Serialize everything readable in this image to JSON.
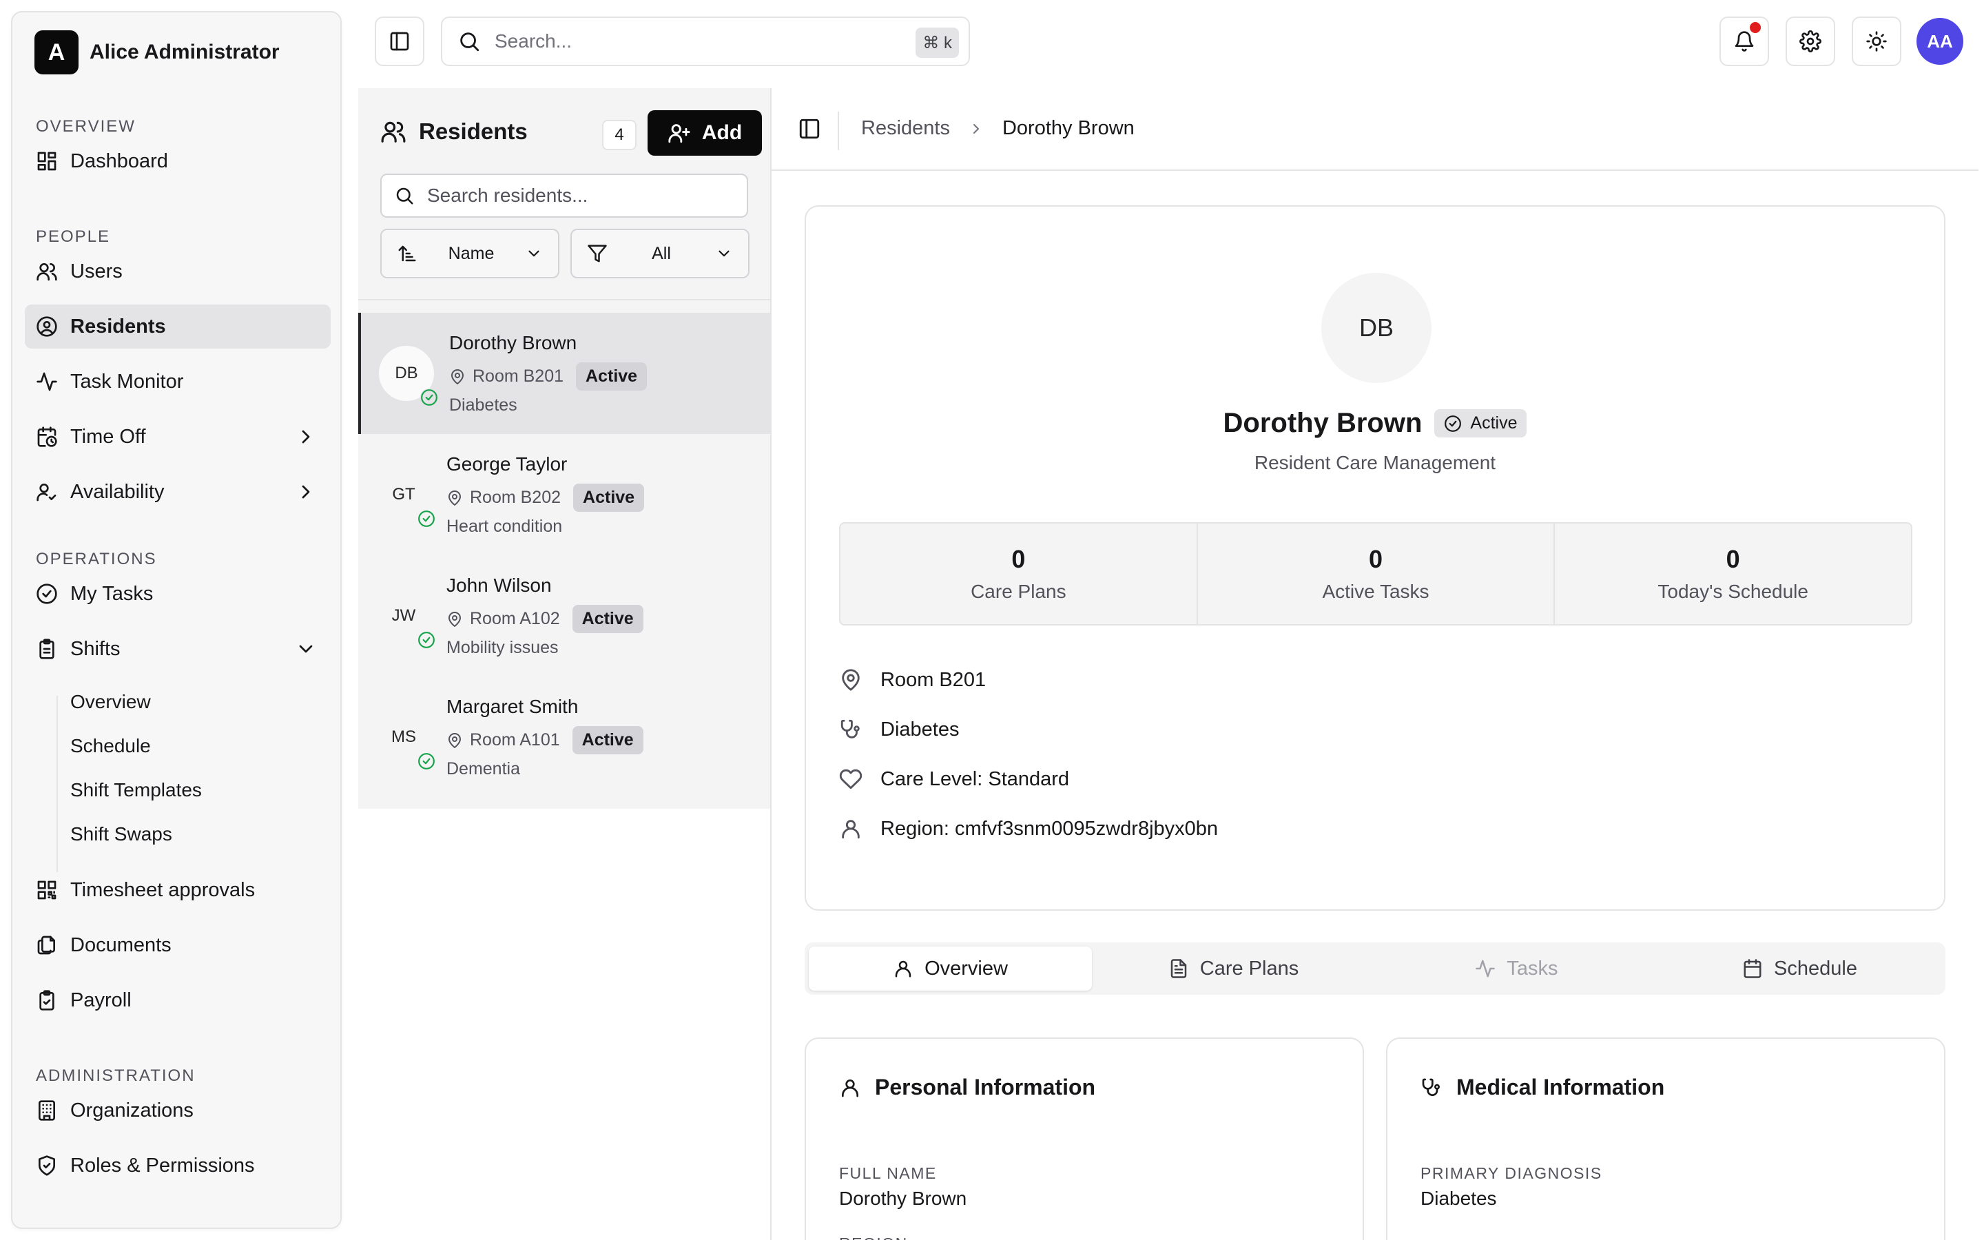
{
  "app": {
    "user_name": "Alice Administrator",
    "logo_letter": "A"
  },
  "sidebar": {
    "sections": {
      "overview": "OVERVIEW",
      "people": "PEOPLE",
      "operations": "OPERATIONS",
      "administration": "ADMINISTRATION"
    },
    "items": {
      "dashboard": "Dashboard",
      "users": "Users",
      "residents": "Residents",
      "task_monitor": "Task Monitor",
      "time_off": "Time Off",
      "availability": "Availability",
      "my_tasks": "My Tasks",
      "shifts": "Shifts",
      "timesheet_approvals": "Timesheet approvals",
      "documents": "Documents",
      "payroll": "Payroll",
      "organizations": "Organizations",
      "roles_permissions": "Roles & Permissions"
    },
    "shifts_sub": [
      "Overview",
      "Schedule",
      "Shift Templates",
      "Shift Swaps"
    ],
    "active_item": "Residents"
  },
  "topbar": {
    "search_placeholder": "Search...",
    "search_shortcut": "⌘ k",
    "avatar_initials": "AA",
    "has_notification": true
  },
  "residents_panel": {
    "title": "Residents",
    "count": "4",
    "add_label": "Add",
    "search_placeholder": "Search residents...",
    "sort_label": "Name",
    "filter_label": "All",
    "list": [
      {
        "initials": "DB",
        "name": "Dorothy Brown",
        "room": "Room B201",
        "status": "Active",
        "condition": "Diabetes",
        "selected": true
      },
      {
        "initials": "GT",
        "name": "George Taylor",
        "room": "Room B202",
        "status": "Active",
        "condition": "Heart condition",
        "selected": false
      },
      {
        "initials": "JW",
        "name": "John Wilson",
        "room": "Room A102",
        "status": "Active",
        "condition": "Mobility issues",
        "selected": false
      },
      {
        "initials": "MS",
        "name": "Margaret Smith",
        "room": "Room A101",
        "status": "Active",
        "condition": "Dementia",
        "selected": false
      }
    ]
  },
  "detail": {
    "breadcrumb": {
      "parent": "Residents",
      "current": "Dorothy Brown"
    },
    "profile": {
      "initials": "DB",
      "name": "Dorothy Brown",
      "status": "Active",
      "subtitle": "Resident Care Management"
    },
    "stats": [
      {
        "value": "0",
        "label": "Care Plans"
      },
      {
        "value": "0",
        "label": "Active Tasks"
      },
      {
        "value": "0",
        "label": "Today's Schedule"
      }
    ],
    "info": {
      "room": "Room B201",
      "condition": "Diabetes",
      "care_level": "Care Level: Standard",
      "region": "Region: cmfvf3snm0095zwdr8jbyx0bn"
    },
    "tabs": [
      "Overview",
      "Care Plans",
      "Tasks",
      "Schedule"
    ],
    "active_tab": "Overview",
    "personal_card": {
      "title": "Personal Information",
      "full_name_label": "FULL NAME",
      "full_name_value": "Dorothy Brown",
      "next_label": "REGION"
    },
    "medical_card": {
      "title": "Medical Information",
      "diagnosis_label": "PRIMARY DIAGNOSIS",
      "diagnosis_value": "Diabetes"
    }
  },
  "colors": {
    "accent": "#0a0a0a",
    "avatar_bg": "#4f46e5",
    "success": "#16a34a",
    "notification": "#e11d1d"
  }
}
